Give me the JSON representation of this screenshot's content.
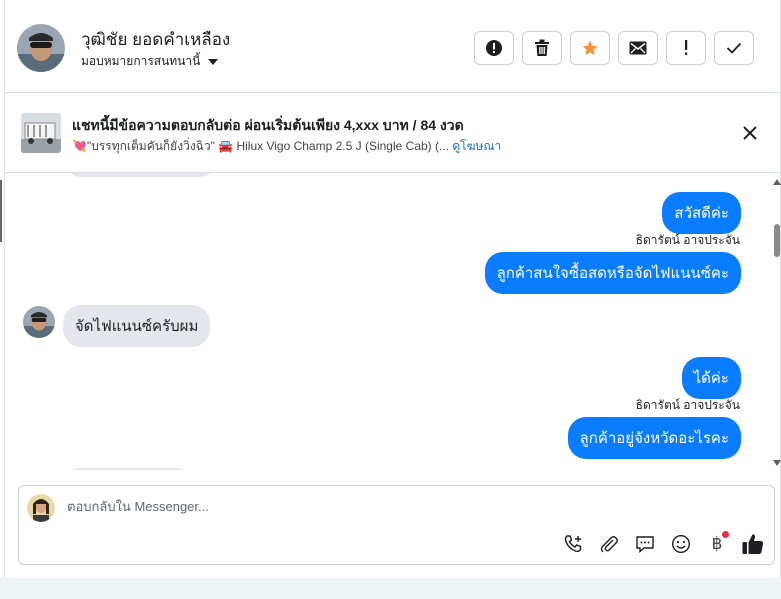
{
  "header": {
    "contact_name": "วุฒิชัย ยอดคำเหลือง",
    "assign_label": "มอบหมายการสนทนานี้",
    "actions": [
      {
        "name": "mark-spam-button",
        "icon": "exclamation-circle-icon"
      },
      {
        "name": "delete-button",
        "icon": "trash-icon"
      },
      {
        "name": "star-button",
        "icon": "star-icon"
      },
      {
        "name": "mark-unread-button",
        "icon": "envelope-icon"
      },
      {
        "name": "follow-up-button",
        "icon": "exclamation-icon"
      },
      {
        "name": "mark-done-button",
        "icon": "checkmark-icon"
      }
    ]
  },
  "ad": {
    "title": "แชทนี้มีข้อความตอบกลับต่อ ผ่อนเริ่มต้นเพียง 4,xxx บาท / 84 งวด",
    "subtitle": "💘\"บรรทุกเต็มคันก็ยังวิ่งฉิว\" 🚘 Hilux Vigo Champ 2.5 J (Single Cab) (...",
    "link": "ดูโฆษณา"
  },
  "messages": [
    {
      "direction": "out",
      "text": "สวัสดีค่ะ"
    },
    {
      "direction": "sender",
      "text": "ธิดารัตน์ อาจประจัน"
    },
    {
      "direction": "out",
      "text": "ลูกค้าสนใจซื้อสดหรือจัดไฟแนนซ์คะ"
    },
    {
      "direction": "in",
      "text": "จัดไฟแนนซ์ครับผม"
    },
    {
      "direction": "out",
      "text": "ได้ค่ะ"
    },
    {
      "direction": "sender",
      "text": "ธิดารัตน์ อาจประจัน"
    },
    {
      "direction": "out",
      "text": "ลูกค้าอยู่จังหวัดอะไรคะ"
    }
  ],
  "composer": {
    "placeholder": "ตอบกลับใน Messenger...",
    "tools": [
      "add-call-icon",
      "paperclip-icon",
      "saved-reply-icon",
      "emoji-icon",
      "baht-payment-icon",
      "thumbs-up-icon"
    ],
    "baht_symbol": "฿"
  },
  "colors": {
    "outgoing_bubble": "#0a7cff",
    "incoming_bubble": "#e4e6eb",
    "star": "#f7923a",
    "link": "#216fdb",
    "notification_dot": "#f02849"
  }
}
